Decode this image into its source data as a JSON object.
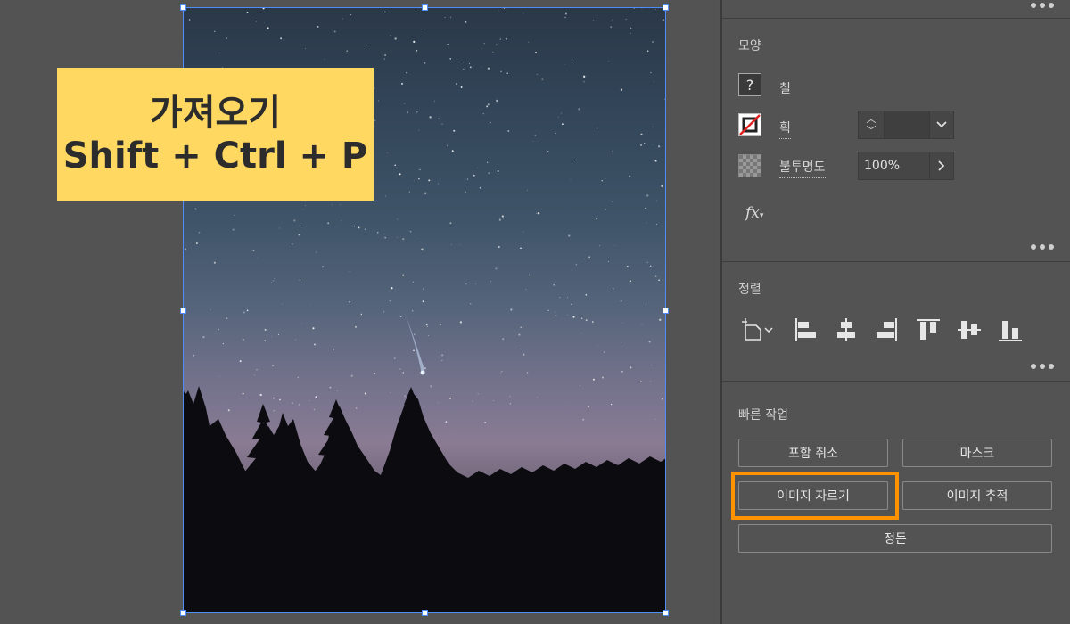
{
  "callout": {
    "line1": "가져오기",
    "line2": "Shift + Ctrl + P",
    "background": "#ffd862"
  },
  "panel": {
    "appearance": {
      "title": "모양",
      "fill_label": "칠",
      "fill_swatch_glyph": "?",
      "stroke_label": "획",
      "opacity_label": "불투명도",
      "opacity_value": "100%",
      "fx_label": "fx"
    },
    "align": {
      "title": "정렬",
      "icons": [
        "align-to-artboard-icon",
        "horizontal-align-left-icon",
        "horizontal-align-center-icon",
        "horizontal-align-right-icon",
        "vertical-align-top-icon",
        "vertical-align-center-icon",
        "vertical-align-bottom-icon"
      ]
    },
    "quick_actions": {
      "title": "빠른 작업",
      "release_clipping": "포함 취소",
      "mask": "마스크",
      "crop_image": "이미지 자르기",
      "image_trace": "이미지 추적",
      "arrange": "정돈"
    }
  },
  "colors": {
    "selection": "#4f8cf7",
    "highlight": "#ff9200",
    "panel_bg": "#535353"
  }
}
